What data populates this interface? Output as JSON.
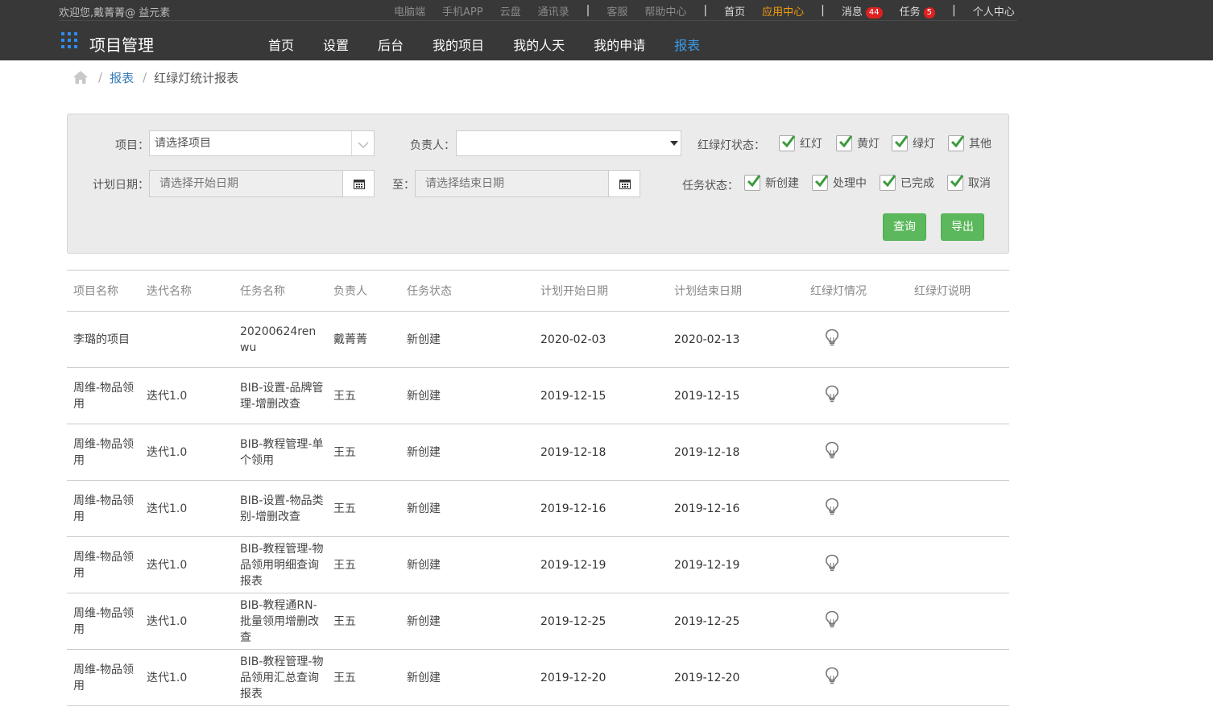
{
  "topbar": {
    "welcome": "欢迎您,戴菁菁@ 益元素",
    "links": [
      "电脑端",
      "手机APP",
      "云盘",
      "通讯录"
    ],
    "service": "客服",
    "help": "帮助中心",
    "home": "首页",
    "app_center": "应用中心",
    "messages": "消息",
    "messages_count": "44",
    "tasks": "任务",
    "tasks_count": "5",
    "personal": "个人中心",
    "separator": "|",
    "accent": "#f39c12"
  },
  "header": {
    "brand": "项目管理",
    "nav": [
      "首页",
      "设置",
      "后台",
      "我的项目",
      "我的人天",
      "我的申请",
      "报表"
    ],
    "active_nav": "报表"
  },
  "breadcrumb": {
    "separator": "/",
    "link": "报表",
    "current": "红绿灯统计报表"
  },
  "filters": {
    "project_label": "项目：",
    "project_placeholder": "请选择项目",
    "owner_label": "负责人：",
    "owner_value": "",
    "light_label": "红绿灯状态：",
    "lights": [
      "红灯",
      "黄灯",
      "绿灯",
      "其他"
    ],
    "date_label": "计划日期：",
    "start_placeholder": "请选择开始日期",
    "to_label": "至：",
    "end_placeholder": "请选择结束日期",
    "task_label": "任务状态：",
    "task_states": [
      "新创建",
      "处理中",
      "已完成",
      "取消"
    ],
    "query_button": "查询",
    "export_button": "导出",
    "button_color": "#5cb85c"
  },
  "table": {
    "columns": [
      "项目名称",
      "迭代名称",
      "任务名称",
      "负责人",
      "任务状态",
      "计划开始日期",
      "计划结束日期",
      "红绿灯情况",
      "红绿灯说明"
    ],
    "rows": [
      [
        "李璐的项目",
        "",
        "20200624renwu",
        "戴菁菁",
        "新创建",
        "2020-02-03",
        "2020-02-13",
        "lightbulb-icon",
        ""
      ],
      [
        "周维-物品领用",
        "迭代1.0",
        "BIB-设置-品牌管理-增删改查",
        "王五",
        "新创建",
        "2019-12-15",
        "2019-12-15",
        "lightbulb-icon",
        ""
      ],
      [
        "周维-物品领用",
        "迭代1.0",
        "BIB-教程管理-单个领用",
        "王五",
        "新创建",
        "2019-12-18",
        "2019-12-18",
        "lightbulb-icon",
        ""
      ],
      [
        "周维-物品领用",
        "迭代1.0",
        "BIB-设置-物品类别-增删改查",
        "王五",
        "新创建",
        "2019-12-16",
        "2019-12-16",
        "lightbulb-icon",
        ""
      ],
      [
        "周维-物品领用",
        "迭代1.0",
        "BIB-教程管理-物品领用明细查询报表",
        "王五",
        "新创建",
        "2019-12-19",
        "2019-12-19",
        "lightbulb-icon",
        ""
      ],
      [
        "周维-物品领用",
        "迭代1.0",
        "BIB-教程通RN-批量领用增删改查",
        "王五",
        "新创建",
        "2019-12-25",
        "2019-12-25",
        "lightbulb-icon",
        ""
      ],
      [
        "周维-物品领用",
        "迭代1.0",
        "BIB-教程管理-物品领用汇总查询报表",
        "王五",
        "新创建",
        "2019-12-20",
        "2019-12-20",
        "lightbulb-icon",
        ""
      ]
    ]
  }
}
